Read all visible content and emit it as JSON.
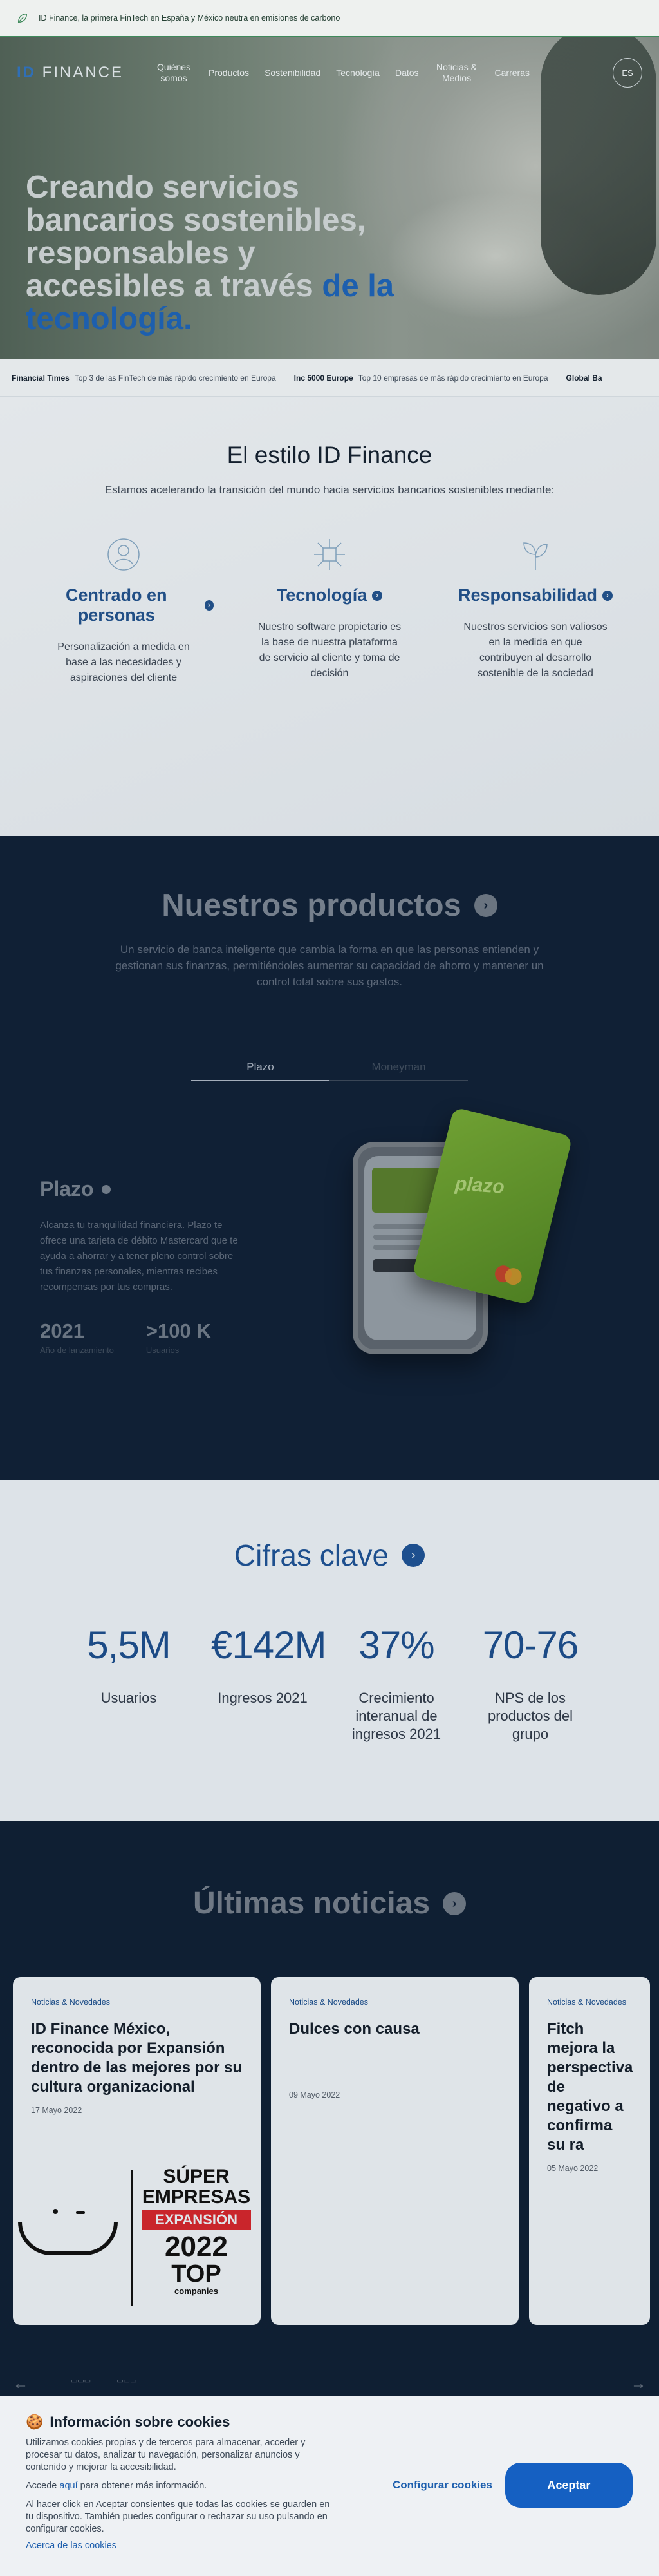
{
  "topbar": {
    "text": "ID Finance, la primera FinTech en España y México neutra en emisiones de carbono"
  },
  "nav": {
    "logo_id": "ID",
    "logo_rest": "FINANCE",
    "items": [
      "Quiénes somos",
      "Productos",
      "Sostenibilidad",
      "Tecnología",
      "Datos",
      "Noticias & Medios",
      "Carreras"
    ],
    "lang": "ES"
  },
  "hero": {
    "title_main": "Creando servicios bancarios sostenibles, responsables y accesibles a través ",
    "title_accent": "de la tecnología."
  },
  "ticker": [
    {
      "source": "Financial Times",
      "text": "Top 3 de las FinTech de más rápido crecimiento en Europa"
    },
    {
      "source": "Inc 5000 Europe",
      "text": "Top 10 empresas de más rápido crecimiento en Europa"
    },
    {
      "source": "Global Ba",
      "text": ""
    }
  ],
  "estilo": {
    "title": "El estilo ID Finance",
    "subtitle": "Estamos acelerando la transición del mundo hacia servicios bancarios sostenibles mediante:",
    "pillars": [
      {
        "title": "Centrado en personas",
        "text": "Personalización a medida en base a las necesidades y aspiraciones del cliente",
        "icon": "person-icon"
      },
      {
        "title": "Tecnología",
        "text": "Nuestro software propietario es la base de nuestra plataforma de servicio al cliente y toma de decisión",
        "icon": "network-icon"
      },
      {
        "title": "Responsabilidad",
        "text": "Nuestros servicios son valiosos en la medida en que contribuyen al desarrollo sostenible de la sociedad",
        "icon": "sprout-icon"
      }
    ]
  },
  "productos": {
    "title": "Nuestros productos",
    "subtitle": "Un servicio de banca inteligente que cambia la forma en que las personas entienden y gestionan sus finanzas, permitiéndoles aumentar su capacidad de ahorro y mantener un control total sobre sus gastos.",
    "tabs": [
      "Plazo",
      "Moneyman"
    ],
    "active_tab": "Plazo",
    "product": {
      "name": "Plazo",
      "description": "Alcanza tu tranquilidad financiera. Plazo te ofrece una tarjeta de débito Mastercard que te ayuda a ahorrar y a tener pleno control sobre tus finanzas personales, mientras recibes recompensas por tus compras.",
      "stats": [
        {
          "value": "2021",
          "label": "Año de lanzamiento"
        },
        {
          "value": ">100 K",
          "label": "Usuarios"
        }
      ],
      "card_word": "plazo"
    }
  },
  "cifras": {
    "title": "Cifras clave",
    "kpis": [
      {
        "value": "5,5M",
        "label": "Usuarios"
      },
      {
        "value": "€142M",
        "label": "Ingresos 2021"
      },
      {
        "value": "37%",
        "label": "Crecimiento interanual de ingresos 2021"
      },
      {
        "value": "70-76",
        "label": "NPS de los productos del grupo"
      }
    ]
  },
  "noticias": {
    "title": "Últimas noticias",
    "cards": [
      {
        "category": "Noticias & Novedades",
        "title": "ID Finance México, reconocida por Expansión dentro de las mejores por su cultura organizacional",
        "date": "17 Mayo 2022"
      },
      {
        "category": "Noticias & Novedades",
        "title": "Dulces con causa",
        "date": "09 Mayo 2022"
      },
      {
        "category": "Noticias & Novedades",
        "title": "Fitch mejora la perspectiva de negativo a confirma su ra",
        "date": "05 Mayo 2022"
      }
    ],
    "badge": {
      "line1": "SÚPER",
      "line2": "EMPRESAS",
      "line3": "EXPANSIÓN",
      "line4": "2022",
      "line5": "TOP",
      "line6": "companies"
    }
  },
  "cookie": {
    "title": "Información sobre cookies",
    "p1": "Utilizamos cookies propias y de terceros para almacenar, acceder y procesar tu datos, analizar tu navegación, personalizar anuncios y contenido y mejorar la accesibilidad.",
    "p2_before": "Accede ",
    "p2_link": "aquí",
    "p2_after": " para obtener más información.",
    "p3": "Al hacer click en Aceptar consientes que todas las cookies se guarden en tu dispositivo. También puedes configurar o rechazar su uso pulsando en configurar cookies.",
    "link": "Acerca de las cookies",
    "configure": "Configurar cookies",
    "accept": "Aceptar"
  },
  "colors": {
    "brand_blue": "#1d4f8e",
    "accent_green": "#3f8a5b",
    "dark_navy": "#0f1f33"
  }
}
